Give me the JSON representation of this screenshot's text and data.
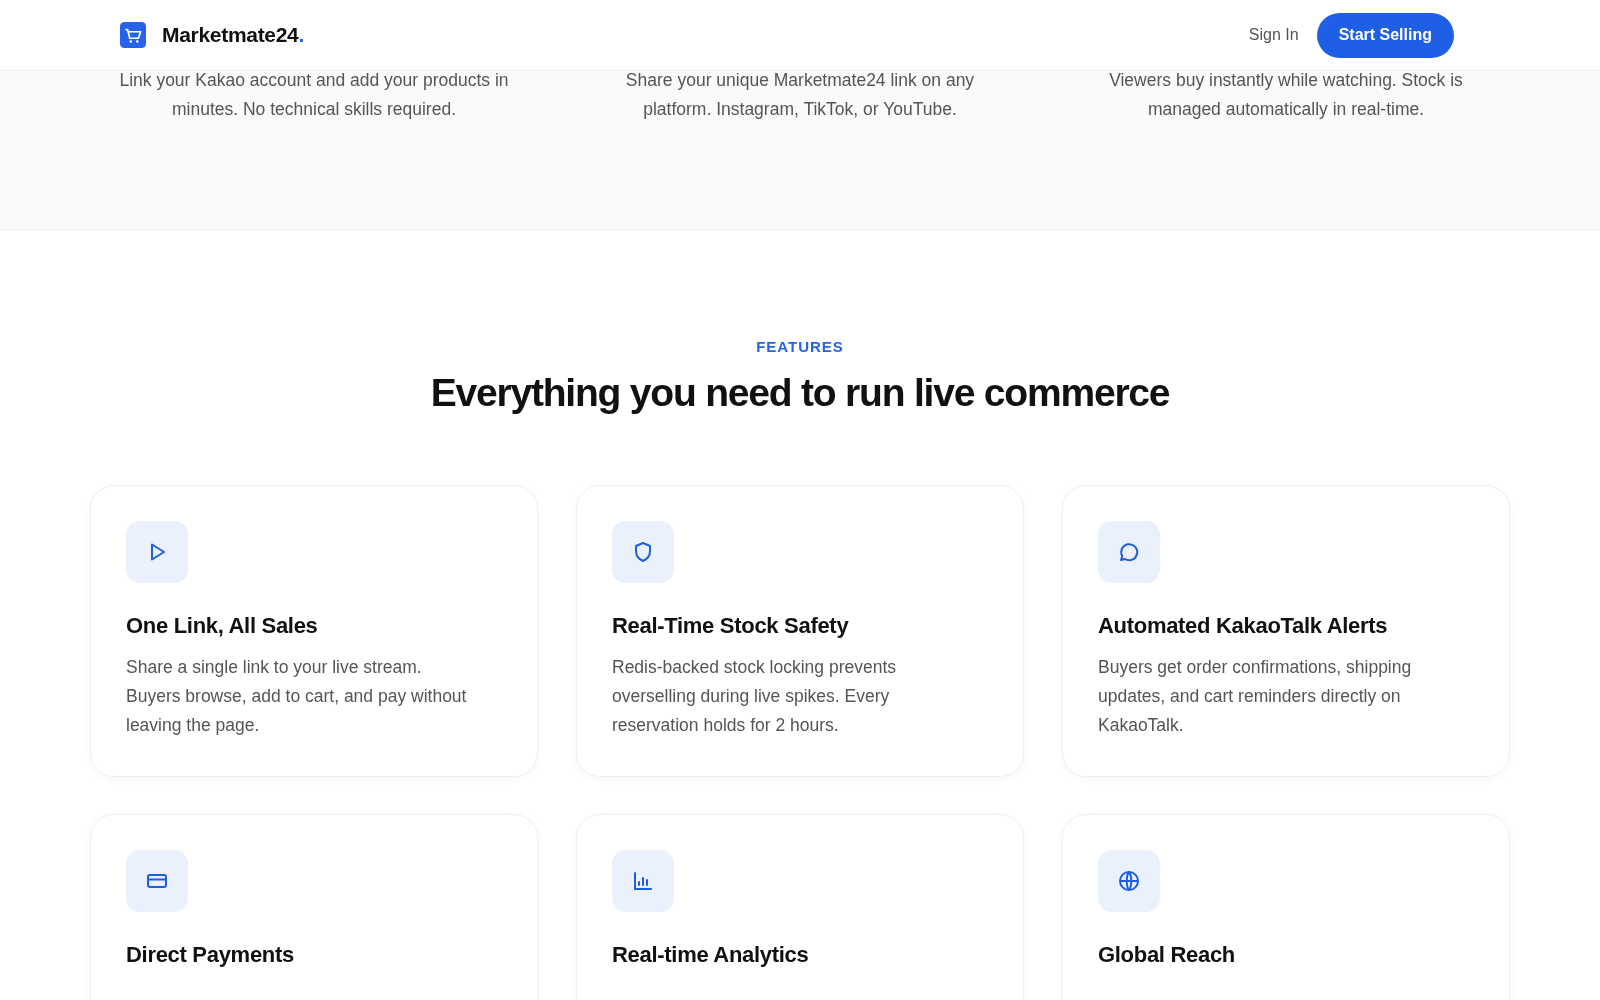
{
  "header": {
    "brand": "Marketmate24",
    "brand_dot": ".",
    "sign_in": "Sign In",
    "cta": "Start Selling"
  },
  "steps": [
    {
      "text": "Link your Kakao account and add your products in minutes. No technical skills required."
    },
    {
      "text": "Share your unique Marketmate24 link on any platform. Instagram, TikTok, or YouTube."
    },
    {
      "text": "Viewers buy instantly while watching. Stock is managed automatically in real-time."
    }
  ],
  "features": {
    "eyebrow": "FEATURES",
    "heading": "Everything you need to run live commerce",
    "cards": [
      {
        "title": "One Link, All Sales",
        "description": "Share a single link to your live stream. Buyers browse, add to cart, and pay without leaving the page."
      },
      {
        "title": "Real-Time Stock Safety",
        "description": "Redis-backed stock locking prevents overselling during live spikes. Every reservation holds for 2 hours."
      },
      {
        "title": "Automated KakaoTalk Alerts",
        "description": "Buyers get order confirmations, shipping updates, and cart reminders directly on KakaoTalk."
      },
      {
        "title": "Direct Payments"
      },
      {
        "title": "Real-time Analytics"
      },
      {
        "title": "Global Reach"
      }
    ]
  }
}
